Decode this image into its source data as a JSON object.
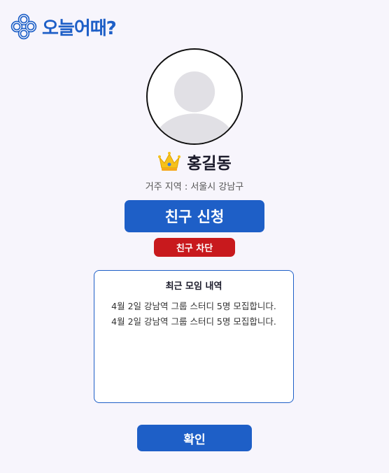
{
  "brand": {
    "name": "오늘어때?"
  },
  "profile": {
    "name": "홍길동",
    "region": "거주 지역 : 서울시 강남구",
    "badge_icon": "crown-icon"
  },
  "actions": {
    "friend_request_label": "친구 신청",
    "block_label": "친구 차단",
    "confirm_label": "확인"
  },
  "history": {
    "title": "최근 모임 내역",
    "items": [
      "4월 2일 강남역 그룹 스터디 5명 모집합니다.",
      "4월 2일 강남역 그룹 스터디 5명 모집합니다."
    ]
  },
  "colors": {
    "primary": "#1e5fc7",
    "danger": "#c8191d",
    "background": "#f7f5fc"
  }
}
